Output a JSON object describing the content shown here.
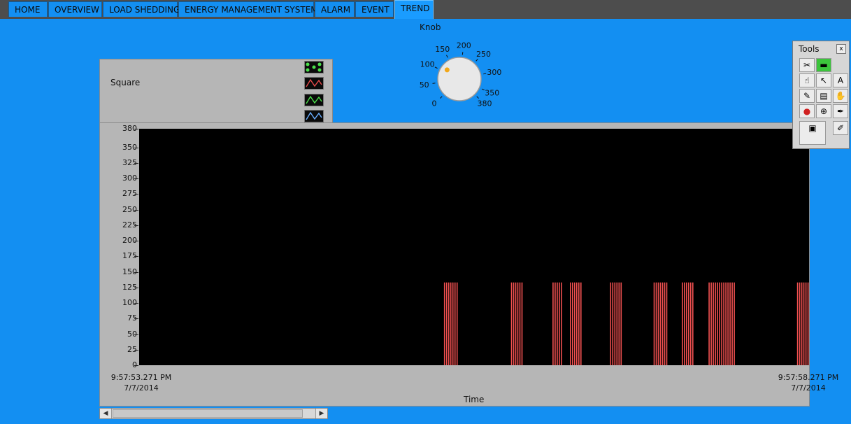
{
  "tabs": [
    {
      "label": "HOME"
    },
    {
      "label": "OVERVIEW"
    },
    {
      "label": "LOAD SHEDDING"
    },
    {
      "label": "ENERGY MANAGEMENT SYSTEM"
    },
    {
      "label": "ALARM"
    },
    {
      "label": "EVENT"
    },
    {
      "label": "TREND",
      "active": true
    }
  ],
  "knob": {
    "label": "Knob",
    "scale": [
      "0",
      "50",
      "100",
      "150",
      "200",
      "250",
      "300",
      "350",
      "380"
    ],
    "value": 115
  },
  "legend": {
    "plot_name": "Square",
    "swatches": [
      "points-icon",
      "red-wave-icon",
      "green-wave-icon",
      "blue-wave-icon"
    ]
  },
  "graph": {
    "y_ticks": [
      "380",
      "350",
      "325",
      "300",
      "275",
      "250",
      "225",
      "200",
      "175",
      "150",
      "125",
      "100",
      "75",
      "50",
      "25",
      "0"
    ],
    "x_start": {
      "time": "9:57:53.271 PM",
      "date": "7/7/2014"
    },
    "x_end": {
      "time": "9:57:58.271 PM",
      "date": "7/7/2014"
    },
    "x_label": "Time"
  },
  "chart_data": {
    "type": "bar",
    "series": [
      {
        "name": "Square",
        "color": "#f05050"
      }
    ],
    "xlim": [
      "9:57:53.271 PM",
      "9:57:58.271 PM"
    ],
    "ylim": [
      0,
      380
    ],
    "ylabel": "",
    "xlabel": "Time",
    "pulse_value": 133,
    "pulse_groups": [
      {
        "start": 0.455,
        "end": 0.474
      },
      {
        "start": 0.555,
        "end": 0.573
      },
      {
        "start": 0.617,
        "end": 0.632
      },
      {
        "start": 0.643,
        "end": 0.659
      },
      {
        "start": 0.703,
        "end": 0.721
      },
      {
        "start": 0.768,
        "end": 0.787
      },
      {
        "start": 0.81,
        "end": 0.828
      },
      {
        "start": 0.85,
        "end": 0.889
      },
      {
        "start": 0.982,
        "end": 1.0
      }
    ]
  },
  "tools": {
    "title": "Tools",
    "items": [
      "auto-tool-icon",
      "status-led-icon",
      "operate-hand-icon",
      "arrow-select-icon",
      "text-A-icon",
      "wiring-spool-icon",
      "shortcut-menu-icon",
      "scroll-hand-icon",
      "breakpoint-icon",
      "probe-icon",
      "color-pick-icon",
      "color-swatch-icon",
      "color-brush-icon"
    ]
  }
}
